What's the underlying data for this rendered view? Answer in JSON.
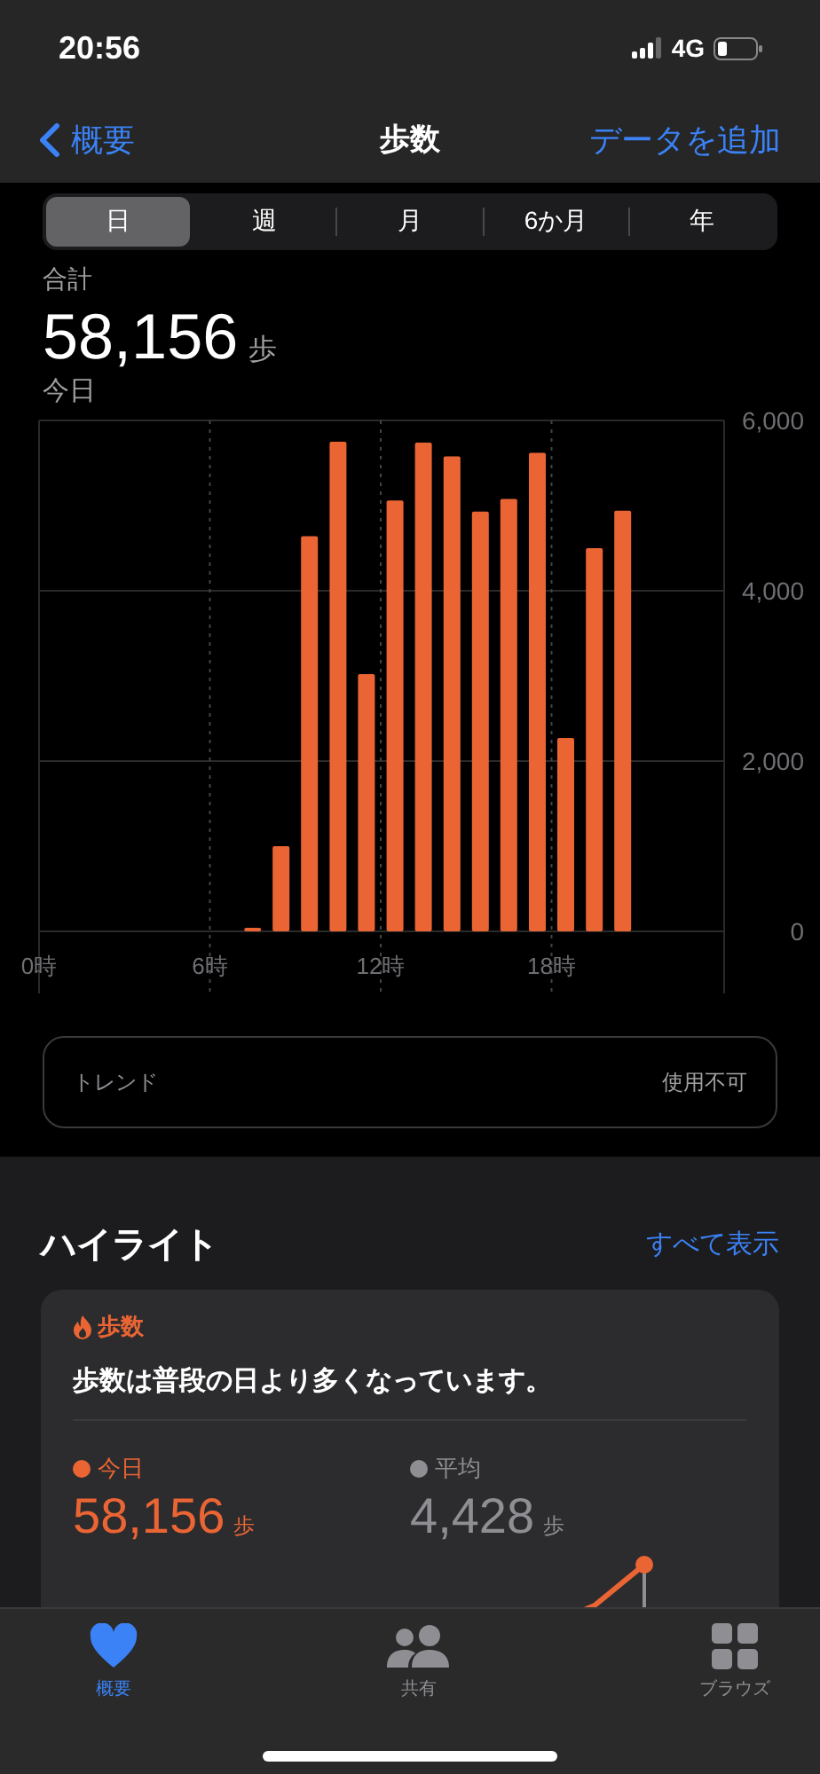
{
  "status_bar": {
    "time": "20:56",
    "network": "4G"
  },
  "nav": {
    "back": "概要",
    "title": "歩数",
    "action": "データを追加"
  },
  "segments": [
    {
      "label": "日",
      "selected": true
    },
    {
      "label": "週",
      "selected": false
    },
    {
      "label": "月",
      "selected": false
    },
    {
      "label": "6か月",
      "selected": false
    },
    {
      "label": "年",
      "selected": false
    }
  ],
  "summary": {
    "label": "合計",
    "value": "58,156",
    "unit": "歩",
    "date": "今日"
  },
  "chart_data": {
    "type": "bar",
    "x": [
      7.5,
      8.5,
      9.5,
      10.5,
      11.5,
      12.5,
      13.5,
      14.5,
      15.5,
      16.5,
      17.5,
      18.5,
      19.5,
      20.5
    ],
    "series": [
      {
        "color": "#eb6534",
        "values": [
          40,
          1000,
          4640,
          5750,
          3020,
          5060,
          5740,
          5580,
          4930,
          5080,
          5620,
          2270,
          4500,
          4940
        ]
      }
    ],
    "xlim": [
      0,
      24
    ],
    "grid": true,
    "xticks": [
      {
        "value": 0,
        "label": "0時"
      },
      {
        "value": 6,
        "label": "6時"
      },
      {
        "value": 12,
        "label": "12時"
      },
      {
        "value": 18,
        "label": "18時"
      }
    ],
    "ylim": [
      0,
      6000
    ],
    "yticks": [
      {
        "value": 0,
        "label": "0"
      },
      {
        "value": 2000,
        "label": "2,000"
      },
      {
        "value": 4000,
        "label": "4,000"
      },
      {
        "value": 6000,
        "label": "6,000"
      }
    ]
  },
  "trend": {
    "label": "トレンド",
    "value": "使用不可"
  },
  "highlights": {
    "title": "ハイライト",
    "link": "すべて表示",
    "card": {
      "category": "歩数",
      "message": "歩数は普段の日より多くなっています。",
      "stats": [
        {
          "label": "今日",
          "value": "58,156",
          "unit": "歩",
          "color": "#eb6534"
        },
        {
          "label": "平均",
          "value": "4,428",
          "unit": "歩",
          "color": "#8e8e93"
        }
      ]
    }
  },
  "tab_bar": [
    {
      "label": "概要",
      "kind": "heart",
      "selected": true
    },
    {
      "label": "共有",
      "kind": "people",
      "selected": false
    },
    {
      "label": "ブラウズ",
      "kind": "grid",
      "selected": false
    }
  ]
}
